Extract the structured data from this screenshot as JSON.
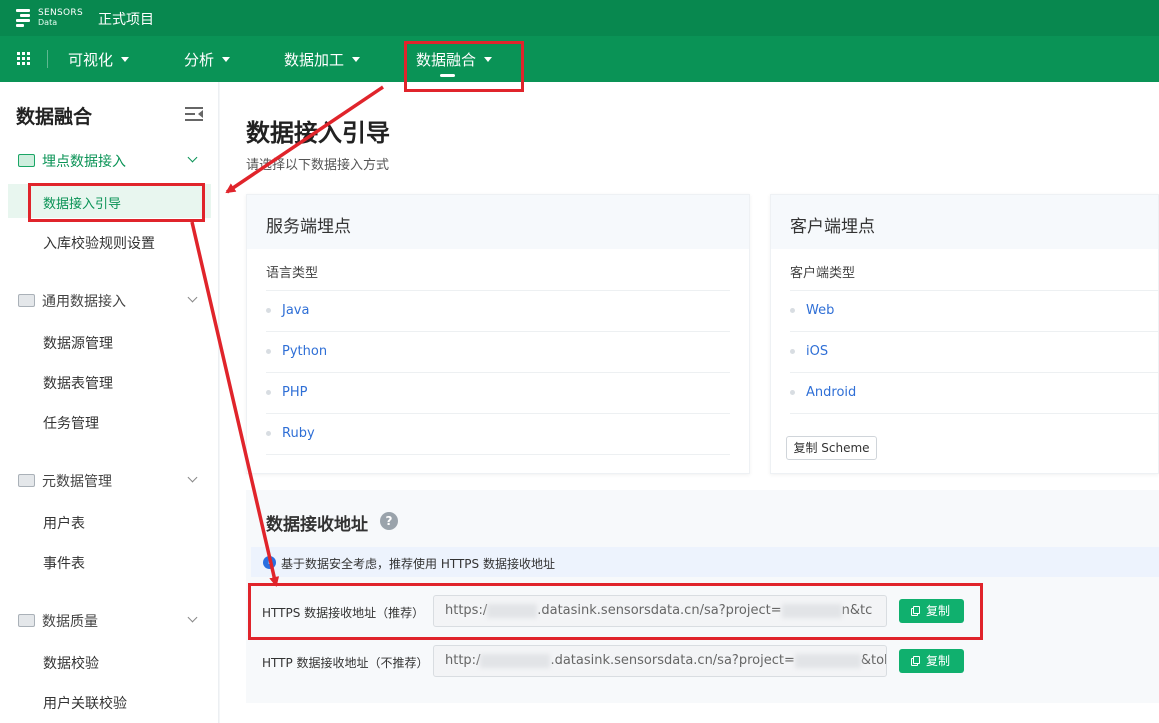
{
  "header": {
    "logo_text": "SENSORS",
    "logo_subtext": "Data",
    "project_name": "正式项目"
  },
  "nav": {
    "items": [
      {
        "label": "可视化"
      },
      {
        "label": "分析"
      },
      {
        "label": "数据加工"
      },
      {
        "label": "数据融合",
        "active": true
      }
    ]
  },
  "sidebar": {
    "title": "数据融合",
    "groups": [
      {
        "label": "埋点数据接入",
        "active": true,
        "items": [
          "数据接入引导",
          "入库校验规则设置"
        ]
      },
      {
        "label": "通用数据接入",
        "items": [
          "数据源管理",
          "数据表管理",
          "任务管理"
        ]
      },
      {
        "label": "元数据管理",
        "items": [
          "用户表",
          "事件表"
        ]
      },
      {
        "label": "数据质量",
        "items": [
          "数据校验",
          "用户关联校验"
        ]
      }
    ]
  },
  "main": {
    "title": "数据接入引导",
    "subtitle": "请选择以下数据接入方式",
    "server_card": {
      "title": "服务端埋点",
      "subtitle": "语言类型",
      "languages": [
        "Java",
        "Python",
        "PHP",
        "Ruby"
      ]
    },
    "client_card": {
      "title": "客户端埋点",
      "subtitle": "客户端类型",
      "clients": [
        "Web",
        "iOS",
        "Android"
      ],
      "copy_scheme_label": "复制 Scheme"
    },
    "receive": {
      "title": "数据接收地址",
      "help_glyph": "?",
      "info_glyph": "i",
      "info_text": "基于数据安全考虑，推荐使用 HTTPS 数据接收地址",
      "rows": [
        {
          "label": "HTTPS 数据接收地址（推荐）",
          "prefix": "https:/",
          "middle": ".datasink.sensorsdata.cn/sa?project=",
          "suffix": "n&tc",
          "copy_label": "复制"
        },
        {
          "label": "HTTP 数据接收地址（不推荐）",
          "prefix": "http:/",
          "middle": ".datasink.sensorsdata.cn/sa?project=",
          "suffix": "&tok",
          "copy_label": "复制"
        }
      ]
    }
  },
  "colors": {
    "brand_green": "#0a9356",
    "header_green": "#08884f",
    "active_text": "#0a9356",
    "link_blue": "#2f6fd6",
    "annotation_red": "#e0242b"
  },
  "icons": {
    "grid": "app-grid-icon",
    "collapse": "collapse-sidebar-icon",
    "group": "folder-icon",
    "help": "help-icon",
    "info": "info-icon",
    "copy": "copy-icon"
  }
}
